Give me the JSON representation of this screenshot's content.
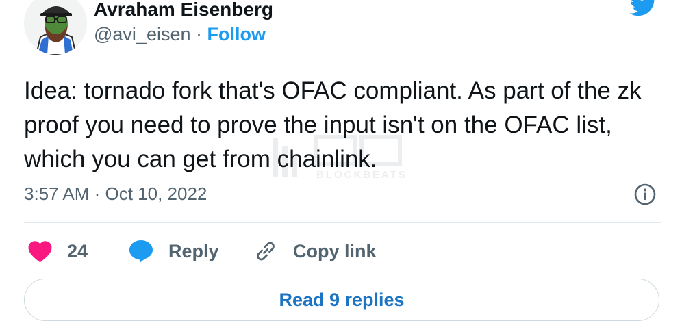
{
  "author": {
    "name": "Avraham Eisenberg",
    "handle": "@avi_eisen",
    "separator": "·",
    "follow_label": "Follow"
  },
  "tweet": {
    "text": "Idea: tornado fork that's OFAC compliant. As part of the zk proof you need to prove the input isn't on the OFAC list, which you can get from chainlink.",
    "timestamp": "3:57 AM · Oct 10, 2022"
  },
  "actions": {
    "like_count": "24",
    "reply_label": "Reply",
    "copy_label": "Copy link"
  },
  "read_replies_label": "Read 9 replies",
  "watermark": {
    "text": "BLOCKBEATS"
  },
  "icons": {
    "twitter": "twitter-bird-icon",
    "info": "info-icon",
    "like": "heart-icon",
    "reply": "speech-bubble-icon",
    "copy": "link-icon"
  },
  "colors": {
    "brand_blue": "#1d9bf0",
    "like_pink": "#f91880",
    "muted_text": "#536471",
    "link_text": "#1d74c3"
  }
}
